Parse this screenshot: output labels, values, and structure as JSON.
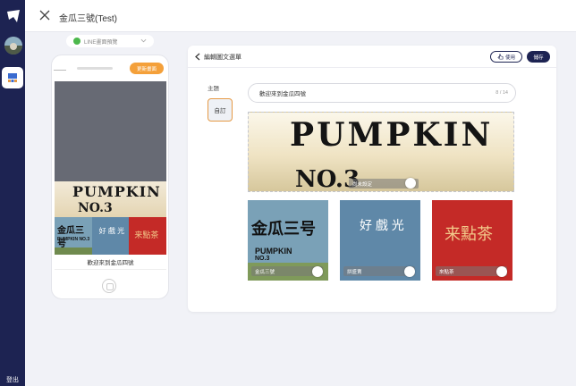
{
  "sidebar": {
    "logout_label": "登出"
  },
  "topbar": {
    "title": "金瓜三號(Test)"
  },
  "preview": {
    "select_value": "LINE畫面預覽",
    "brand_color": "#1d2352"
  },
  "phone": {
    "top_button": "更新畫面",
    "hero_line1": "PUMPKIN",
    "hero_line2": "NO.3",
    "caption": "歡迎來到金瓜四號",
    "thumbs": [
      {
        "text": "金瓜三号",
        "sub": "PUMPKIN NO.3"
      },
      {
        "text": "好 戲 光",
        "sub": ""
      },
      {
        "text": "来點茶",
        "sub": ""
      }
    ]
  },
  "editor": {
    "title": "編輯圖文選單",
    "use_label": "使用",
    "save_label": "儲存",
    "theme_label": "主題",
    "custom_tab": "自訂",
    "title_value": "歡迎來到金瓜四號",
    "title_count": "8 / 14",
    "big_slot": {
      "line1": "PUMPKIN",
      "line2": "NO.3",
      "label": "尚未設定"
    },
    "small_slots": [
      {
        "brand": "金瓜三号",
        "line1": "PUMPKIN",
        "line2": "NO.3",
        "label": "金瓜三號",
        "bg": "#7aa1b7"
      },
      {
        "brand": "好 戲 光",
        "line1": "",
        "line2": "",
        "label": "拼盛賣",
        "bg": "#5f88a8"
      },
      {
        "brand": "来點茶",
        "line1": "",
        "line2": "",
        "label": "來點茶",
        "bg": "#c42a27"
      }
    ]
  }
}
